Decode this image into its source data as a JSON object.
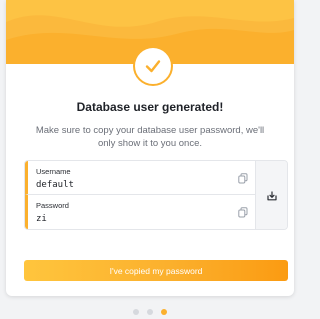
{
  "dialog": {
    "title": "Database user generated!",
    "subtitle": "Make sure to copy your database user password, we'll only show it to you once."
  },
  "credentials": {
    "username_label": "Username",
    "username_value": "default",
    "password_label": "Password",
    "password_value": "zi"
  },
  "actions": {
    "confirm_label": "I've copied my password"
  },
  "icons": {
    "header": "check-icon",
    "copy": "copy-icon",
    "download": "download-icon"
  },
  "pagination": {
    "total_steps": 3,
    "current_step": 3
  },
  "colors": {
    "accent": "#fbb02d",
    "accent_light": "#ffc53d",
    "accent_dark": "#fb9b12",
    "title_text": "#1f2228",
    "muted_text": "#6b6f78"
  }
}
